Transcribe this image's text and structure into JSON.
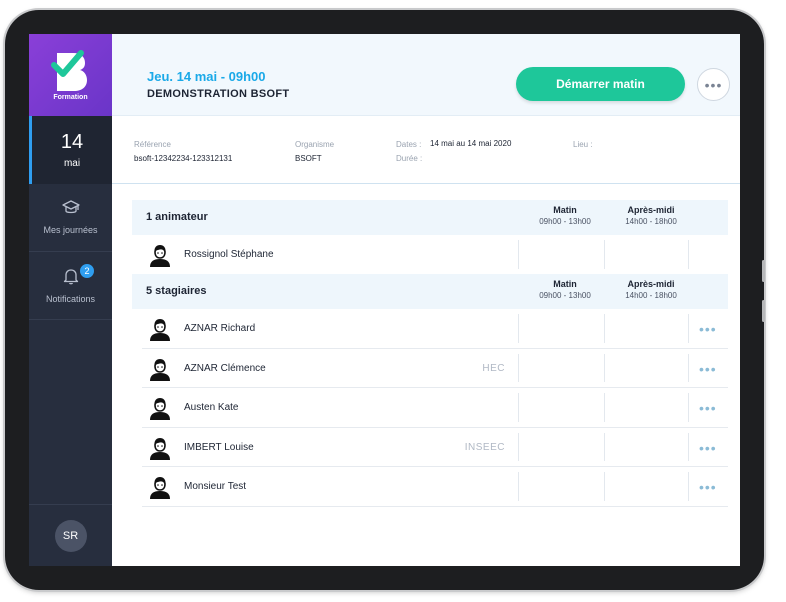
{
  "sidebar": {
    "logo_text": "Formation",
    "date": {
      "day": "14",
      "month": "mai"
    },
    "items": [
      {
        "label": "Mes journées",
        "icon": "graduation-cap-icon"
      },
      {
        "label": "Notifications",
        "icon": "bell-icon",
        "badge": "2"
      }
    ],
    "user_initials": "SR"
  },
  "header": {
    "date_time": "Jeu. 14 mai - 09h00",
    "title": "DEMONSTRATION BSOFT",
    "start_button": "Démarrer matin",
    "more_button": "•••"
  },
  "info": {
    "reference_label": "Référence",
    "reference_value": "bsoft-12342234-123312131",
    "organisme_label": "Organisme",
    "organisme_value": "BSOFT",
    "dates_label": "Dates :",
    "dates_value": "14 mai au 14 mai 2020",
    "duree_label": "Durée :",
    "lieu_label": "Lieu :"
  },
  "animateurs": {
    "title": "1 animateur",
    "col_matin": "Matin",
    "col_matin_hours": "09h00 - 13h00",
    "col_apres": "Après-midi",
    "col_apres_hours": "14h00 - 18h00",
    "rows": [
      {
        "name": "Rossignol Stéphane",
        "school": ""
      }
    ]
  },
  "stagiaires": {
    "title": "5 stagiaires",
    "col_matin": "Matin",
    "col_matin_hours": "09h00 - 13h00",
    "col_apres": "Après-midi",
    "col_apres_hours": "14h00 - 18h00",
    "row_more": "•••",
    "rows": [
      {
        "name": "AZNAR Richard",
        "school": ""
      },
      {
        "name": "AZNAR Clémence",
        "school": "HEC"
      },
      {
        "name": "Austen Kate",
        "school": ""
      },
      {
        "name": "IMBERT Louise",
        "school": "INSEEC"
      },
      {
        "name": "Monsieur Test",
        "school": ""
      }
    ]
  },
  "colors": {
    "accent_blue": "#1aa9e8",
    "start_green": "#1ec79a",
    "sidebar_bg": "#272e3e",
    "logo_purple": "#7a3ad0"
  }
}
